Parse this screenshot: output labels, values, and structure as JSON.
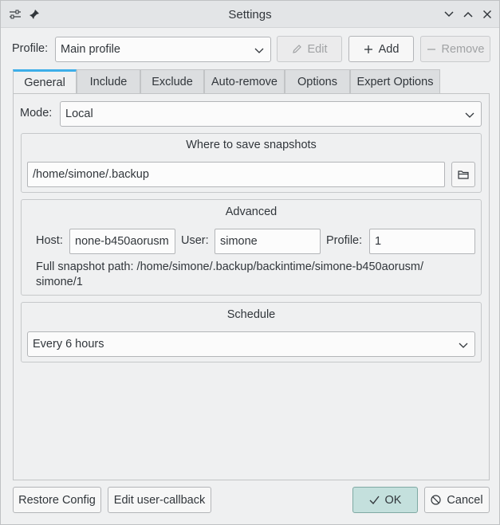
{
  "window": {
    "title": "Settings"
  },
  "profile": {
    "label": "Profile:",
    "selected": "Main profile",
    "edit_label": "Edit",
    "add_label": "Add",
    "remove_label": "Remove"
  },
  "tabs": [
    {
      "label": "General",
      "active": true
    },
    {
      "label": "Include"
    },
    {
      "label": "Exclude"
    },
    {
      "label": "Auto-remove"
    },
    {
      "label": "Options"
    },
    {
      "label": "Expert Options"
    }
  ],
  "general": {
    "mode_label": "Mode:",
    "mode_value": "Local",
    "where": {
      "title": "Where to save snapshots",
      "path": "/home/simone/.backup"
    },
    "advanced": {
      "title": "Advanced",
      "host_label": "Host:",
      "host_value": "none-b450aorusm",
      "user_label": "User:",
      "user_value": "simone",
      "profile_label": "Profile:",
      "profile_value": "1",
      "full_path_line1": "Full snapshot path: /home/simone/.backup/backintime/simone-b450aorusm/",
      "full_path_line2": "simone/1"
    },
    "schedule": {
      "title": "Schedule",
      "value": "Every 6 hours"
    }
  },
  "footer": {
    "restore_label": "Restore Config",
    "edit_callback_label": "Edit user-callback",
    "ok_label": "OK",
    "cancel_label": "Cancel"
  },
  "colors": {
    "accent": "#3daee9",
    "ok_bg": "#c4e0dd"
  },
  "icons": [
    "settings-sliders-icon",
    "pin-icon",
    "minimize-icon",
    "maximize-icon",
    "close-icon",
    "pencil-icon",
    "plus-icon",
    "minus-icon",
    "chevron-down-icon",
    "folder-icon",
    "check-icon",
    "cancel-circle-icon"
  ]
}
